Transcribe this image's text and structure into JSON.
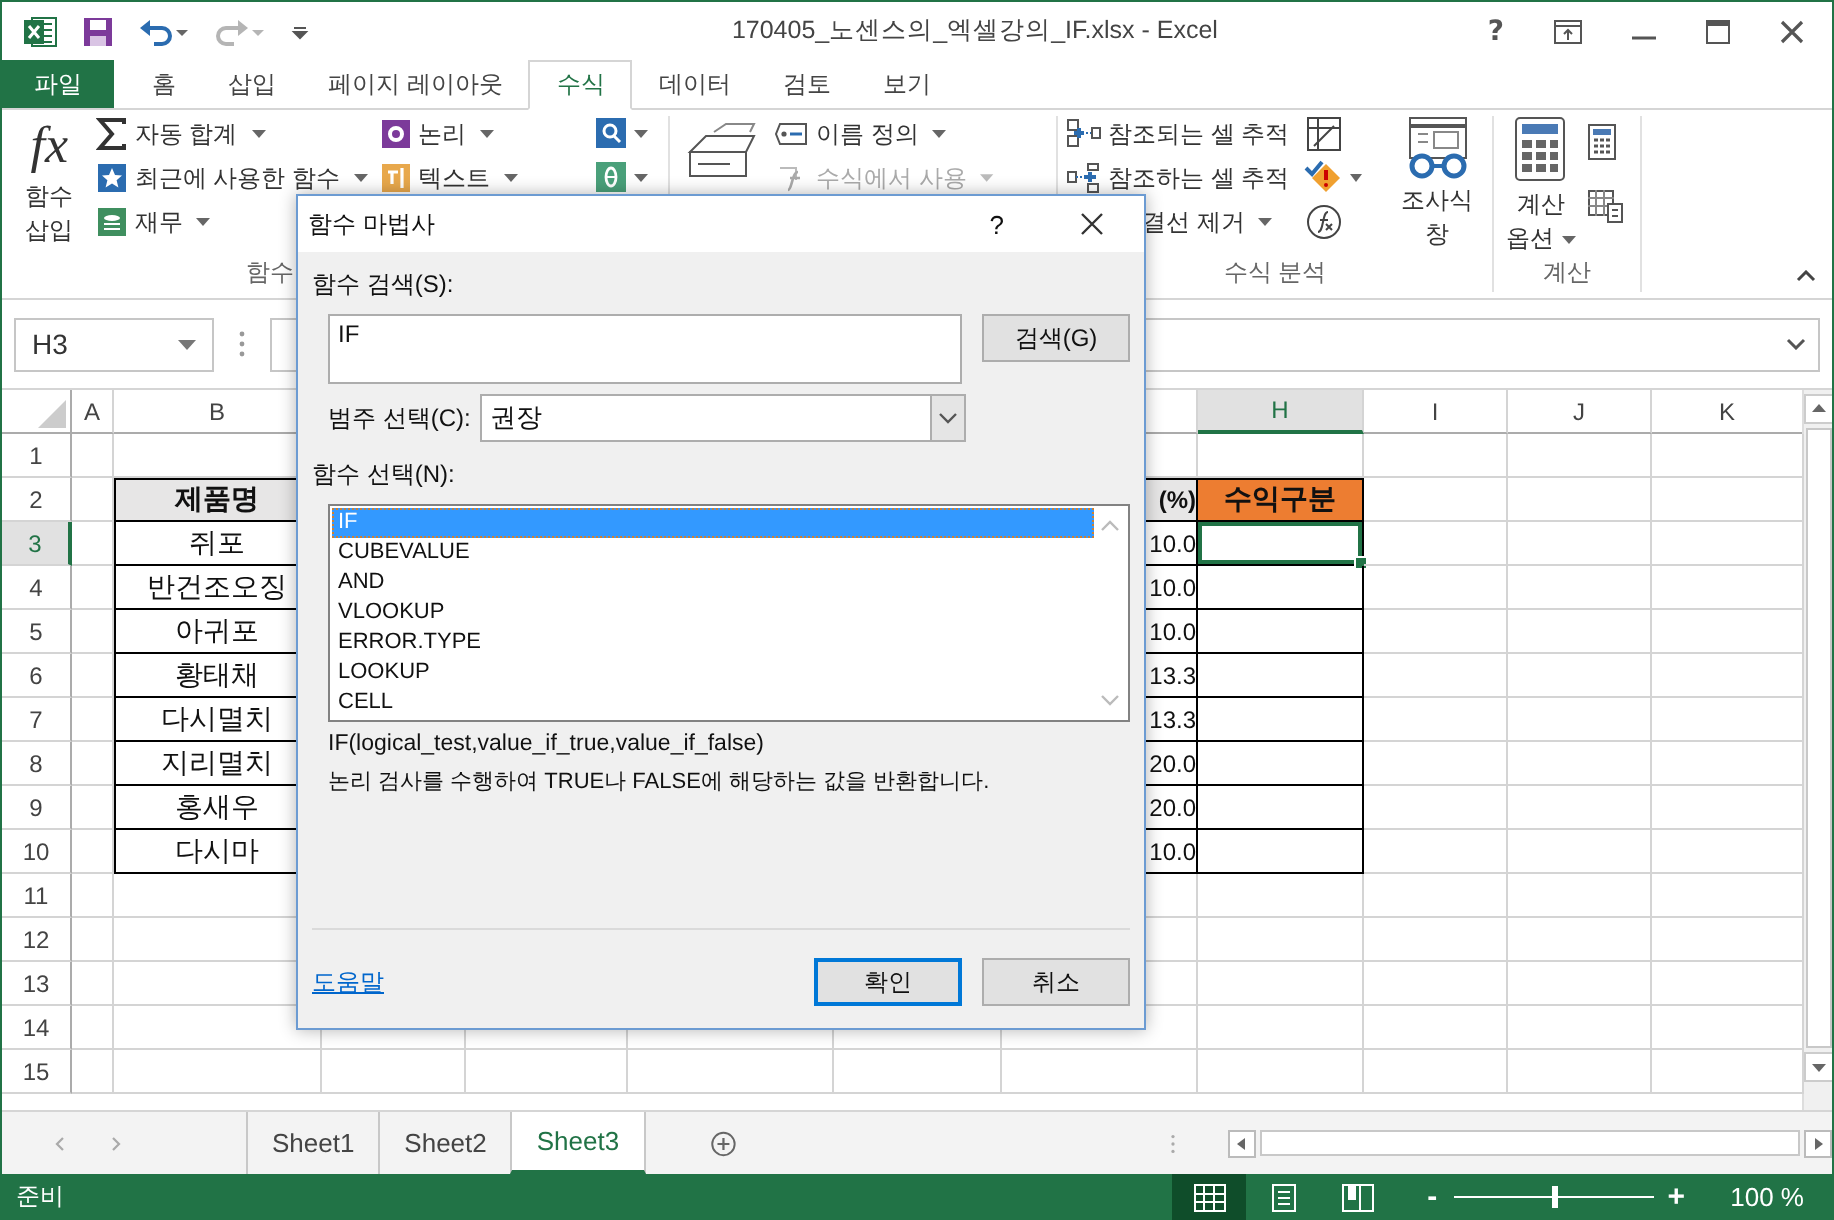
{
  "window": {
    "title": "170405_노센스의_엑셀강의_IF.xlsx - Excel",
    "help": "?"
  },
  "tabs": [
    {
      "label": "파일",
      "kind": "file",
      "selected": false
    },
    {
      "label": "홈",
      "kind": "tab",
      "selected": false
    },
    {
      "label": "삽입",
      "kind": "tab",
      "selected": false
    },
    {
      "label": "페이지 레이아웃",
      "kind": "tab",
      "selected": false
    },
    {
      "label": "수식",
      "kind": "tab",
      "selected": true
    },
    {
      "label": "데이터",
      "kind": "tab",
      "selected": false
    },
    {
      "label": "검토",
      "kind": "tab",
      "selected": false
    },
    {
      "label": "보기",
      "kind": "tab",
      "selected": false
    }
  ],
  "ribbon": {
    "insert_function": {
      "icon_text": "fx",
      "lines": [
        "함수",
        "삽입"
      ]
    },
    "library": [
      {
        "label": "자동 합계",
        "dropdown": true
      },
      {
        "label": "최근에 사용한 함수",
        "dropdown": true
      },
      {
        "label": "재무",
        "dropdown": true
      },
      {
        "label": "논리",
        "dropdown": true
      },
      {
        "label": "텍스트",
        "dropdown": true
      }
    ],
    "names": [
      {
        "label": "이름 정의",
        "dropdown": true,
        "disabled": false
      },
      {
        "label": "수식에서 사용",
        "dropdown": true,
        "disabled": true
      }
    ],
    "audit": [
      {
        "label": "참조되는 셀 추적",
        "dropdown": false
      },
      {
        "label": "참조하는 셀 추적",
        "dropdown": false
      },
      {
        "label": "결선 제거",
        "dropdown": true
      }
    ],
    "watch": {
      "lines": [
        "조사식",
        "창"
      ]
    },
    "calc": {
      "lines": [
        "계산",
        "옵션"
      ],
      "dropdown": true
    },
    "group_labels": [
      "함수",
      "수식 분석",
      "계산"
    ]
  },
  "formula_bar": {
    "name_box": "H3"
  },
  "sheet": {
    "columns": [
      {
        "label": "A",
        "selected": false
      },
      {
        "label": "B",
        "selected": false
      },
      {
        "label": "H",
        "selected": true
      },
      {
        "label": "I",
        "selected": false
      },
      {
        "label": "J",
        "selected": false
      },
      {
        "label": "K",
        "selected": false
      }
    ],
    "rows": [
      {
        "label": "1",
        "selected": false
      },
      {
        "label": "2",
        "selected": false
      },
      {
        "label": "3",
        "selected": true
      },
      {
        "label": "4",
        "selected": false
      },
      {
        "label": "5",
        "selected": false
      },
      {
        "label": "6",
        "selected": false
      },
      {
        "label": "7",
        "selected": false
      },
      {
        "label": "8",
        "selected": false
      },
      {
        "label": "9",
        "selected": false
      },
      {
        "label": "10",
        "selected": false
      },
      {
        "label": "11",
        "selected": false
      },
      {
        "label": "12",
        "selected": false
      },
      {
        "label": "13",
        "selected": false
      },
      {
        "label": "14",
        "selected": false
      },
      {
        "label": "15",
        "selected": false
      }
    ],
    "table": {
      "header": [
        {
          "text": "제품명",
          "color": "#e7e6e6"
        },
        {
          "text": "(%)",
          "color": "#e7e6e6"
        },
        {
          "text": "수익구분",
          "color": "#ed7d31"
        }
      ],
      "rows": [
        {
          "cells": [
            {
              "text": "쥐포"
            },
            {
              "text": "10.0"
            },
            {
              "selected": true
            }
          ]
        },
        {
          "cells": [
            {
              "text": "반건조오징"
            },
            {
              "text": "10.0"
            },
            {
              "selected": false
            }
          ]
        },
        {
          "cells": [
            {
              "text": "아귀포"
            },
            {
              "text": "10.0"
            },
            {
              "selected": false
            }
          ]
        },
        {
          "cells": [
            {
              "text": "황태채"
            },
            {
              "text": "13.3"
            },
            {
              "selected": false
            }
          ]
        },
        {
          "cells": [
            {
              "text": "다시멸치"
            },
            {
              "text": "13.3"
            },
            {
              "selected": false
            }
          ]
        },
        {
          "cells": [
            {
              "text": "지리멸치"
            },
            {
              "text": "20.0"
            },
            {
              "selected": false
            }
          ]
        },
        {
          "cells": [
            {
              "text": "홍새우"
            },
            {
              "text": "20.0"
            },
            {
              "selected": false
            }
          ]
        },
        {
          "cells": [
            {
              "text": "다시마"
            },
            {
              "text": "10.0"
            },
            {
              "selected": false
            }
          ]
        }
      ]
    }
  },
  "sheet_tabs": [
    {
      "label": "Sheet1",
      "selected": false
    },
    {
      "label": "Sheet2",
      "selected": false
    },
    {
      "label": "Sheet3",
      "selected": true
    }
  ],
  "status_bar": {
    "status": "준비",
    "views": [
      {
        "selected": true
      },
      {
        "selected": false
      },
      {
        "selected": false
      }
    ],
    "zoom": {
      "minus": "-",
      "plus": "+",
      "level": 0.5,
      "reading": "100 %"
    }
  },
  "dialog": {
    "title": "함수 마법사",
    "help": "?",
    "search_label": "함수 검색(S):",
    "search_value": "IF",
    "search_button": "검색(G)",
    "category_label": "범주 선택(C):",
    "category_value": "권장",
    "list_label": "함수 선택(N):",
    "functions": [
      {
        "name": "IF",
        "selected": true
      },
      {
        "name": "CUBEVALUE",
        "selected": false
      },
      {
        "name": "AND",
        "selected": false
      },
      {
        "name": "VLOOKUP",
        "selected": false
      },
      {
        "name": "ERROR.TYPE",
        "selected": false
      },
      {
        "name": "LOOKUP",
        "selected": false
      },
      {
        "name": "CELL",
        "selected": false
      }
    ],
    "signature": "IF(logical_test,value_if_true,value_if_false)",
    "description": "논리 검사를 수행하여 TRUE나 FALSE에 해당하는 값을 반환합니다.",
    "help_link": "도움말",
    "ok": "확인",
    "cancel": "취소"
  }
}
